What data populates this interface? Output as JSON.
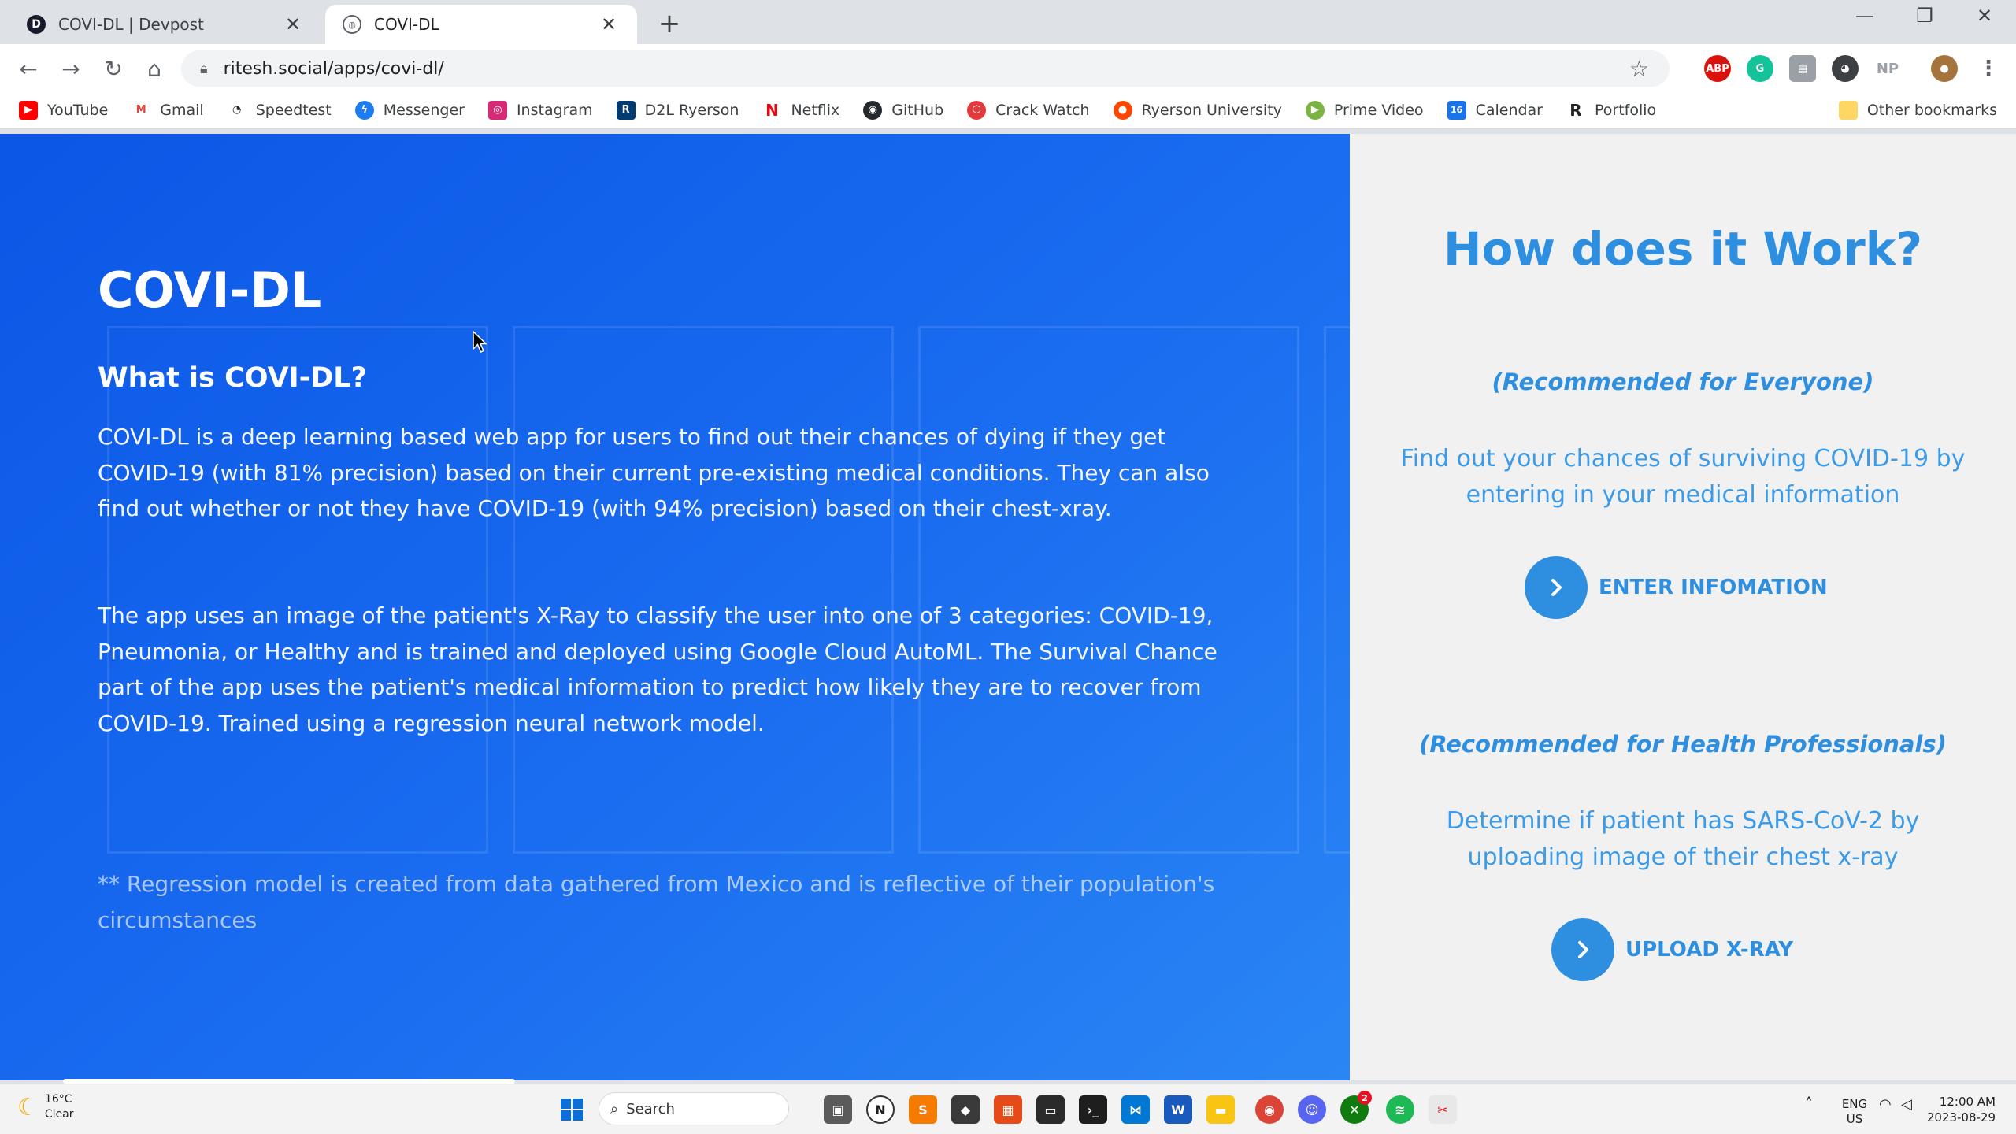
{
  "browser": {
    "tabs": [
      {
        "title": "COVI-DL | Devpost",
        "favicon": "devpost-icon",
        "active": false
      },
      {
        "title": "COVI-DL",
        "favicon": "globe-icon",
        "active": true
      }
    ],
    "url": "ritesh.social/apps/covi-dl/",
    "extensions": [
      "ABP",
      "G",
      "NP"
    ],
    "bookmarks": [
      "YouTube",
      "Gmail",
      "Speedtest",
      "Messenger",
      "Instagram",
      "D2L Ryerson",
      "Netflix",
      "GitHub",
      "Crack Watch",
      "Ryerson University",
      "Prime Video",
      "Calendar",
      "Portfolio"
    ],
    "other_bookmarks": "Other bookmarks"
  },
  "cover": {
    "title": "COVI-DL",
    "subtitle": "What is COVI-DL?",
    "paragraph1": "COVI-DL is a deep learning based web app for users to find out their chances of dying if they get COVID-19 (with 81% precision) based on their current pre-existing medical conditions. They can also find out whether or not they have COVID-19 (with 94% precision) based on their chest-xray.",
    "paragraph2": "The app uses an image of the patient's X-Ray to classify the user into one of 3 categories: COVID-19, Pneumonia, or Healthy and is trained and deployed using Google Cloud AutoML. The Survival Chance part of the app uses the patient's medical information to predict how likely they are to recover from COVID-19. Trained using a regression neural network model.",
    "note": "** Regression model is created from data gathered from Mexico and is reflective of their population's circumstances"
  },
  "how": {
    "title": "How does it Work?",
    "sections": [
      {
        "recommended": "(Recommended for Everyone)",
        "description": "Find out your chances of surviving COVID-19 by entering in your medical information",
        "action": "ENTER INFOMATION"
      },
      {
        "recommended": "(Recommended for Health Professionals)",
        "description": "Determine if patient has SARS-CoV-2 by uploading image of their chest x-ray",
        "action": "UPLOAD X-RAY"
      }
    ]
  },
  "taskbar": {
    "weather_temp": "16°C",
    "weather_cond": "Clear",
    "search_placeholder": "Search",
    "lang": "ENG",
    "region": "US",
    "time": "12:00 AM",
    "date": "2023-08-29",
    "badge_count": "2"
  },
  "colors": {
    "cover_gradient_start": "#0b57e6",
    "cover_gradient_end": "#2a86f4",
    "accent": "#2e8fe0",
    "right_bg": "#f1f1f1"
  }
}
